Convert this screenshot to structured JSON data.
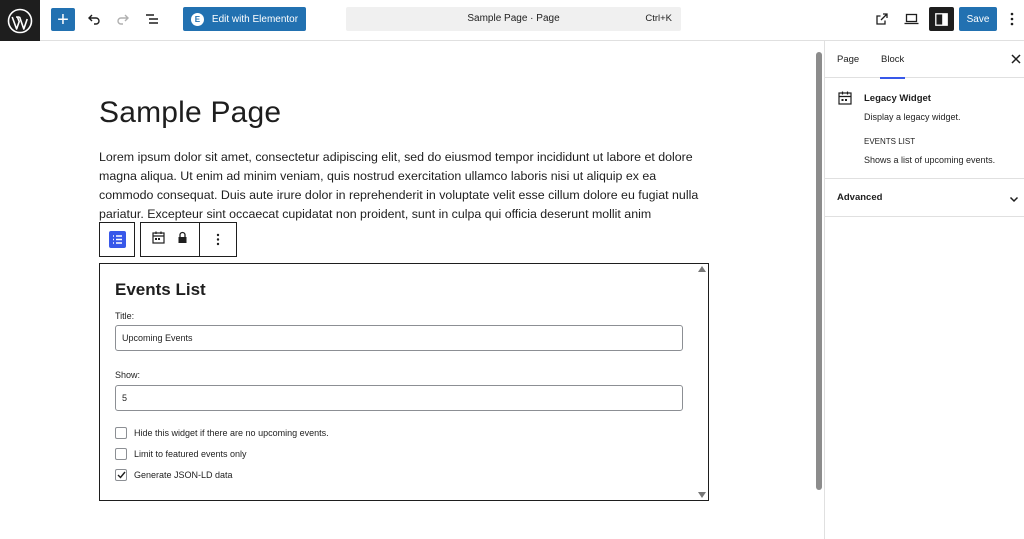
{
  "toolbar": {
    "elementor_label": "Edit with Elementor",
    "document_title": "Sample Page · Page",
    "shortcut": "Ctrl+K",
    "save_label": "Save"
  },
  "content": {
    "page_title": "Sample Page",
    "paragraph_visible": "Lorem ipsum dolor sit amet, consectetur adipiscing elit, sed do eiusmod tempor incididunt ut labore et dolore magna aliqua. Ut enim ad minim veniam, quis nostrud exercitation ullamco laboris nisi ut aliquip ex ea commodo consequat. Duis aute irure dolor in reprehenderit in voluptate velit esse cillum dolore eu fugiat nulla pariatur. Excepteur sint occaecat cupidatat non proident, sunt in culpa qui officia deserunt mollit anim"
  },
  "widget": {
    "heading": "Events List",
    "title_label": "Title:",
    "title_value": "Upcoming Events",
    "show_label": "Show:",
    "show_value": "5",
    "options": [
      {
        "label": "Hide this widget if there are no upcoming events.",
        "checked": false
      },
      {
        "label": "Limit to featured events only",
        "checked": false
      },
      {
        "label": "Generate JSON-LD data",
        "checked": true
      }
    ]
  },
  "sidebar": {
    "tab_page": "Page",
    "tab_block": "Block",
    "block_title": "Legacy Widget",
    "block_description": "Display a legacy widget.",
    "widget_name": "EVENTS LIST",
    "widget_description": "Shows a list of upcoming events.",
    "advanced_label": "Advanced"
  },
  "colors": {
    "accent": "#2271b1",
    "block_accent": "#3858e9",
    "dark": "#1e1e1e"
  }
}
